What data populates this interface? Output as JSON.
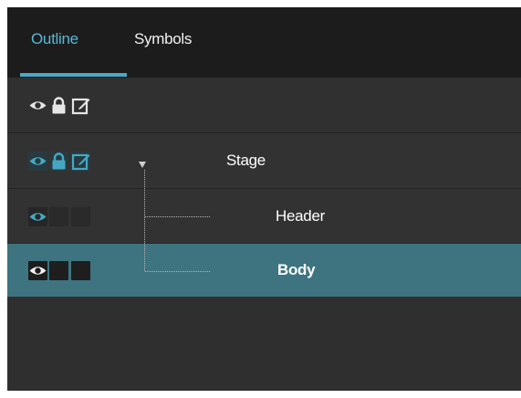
{
  "tabs": [
    {
      "label": "Outline",
      "active": true
    },
    {
      "label": "Symbols",
      "active": false
    }
  ],
  "header_row": {
    "visibility_icon": "eye-icon",
    "lock_icon": "lock-icon",
    "edit_icon": "edit-icon"
  },
  "tree": [
    {
      "label": "Stage",
      "level": 0,
      "expanded": true,
      "selected": false
    },
    {
      "label": "Header",
      "level": 1,
      "selected": false
    },
    {
      "label": "Body",
      "level": 1,
      "selected": true
    }
  ],
  "colors": {
    "accent": "#55b9d6",
    "selected_row": "#3d7480",
    "panel_bg": "#2f2f2f",
    "tabbar_bg": "#1c1c1c"
  }
}
